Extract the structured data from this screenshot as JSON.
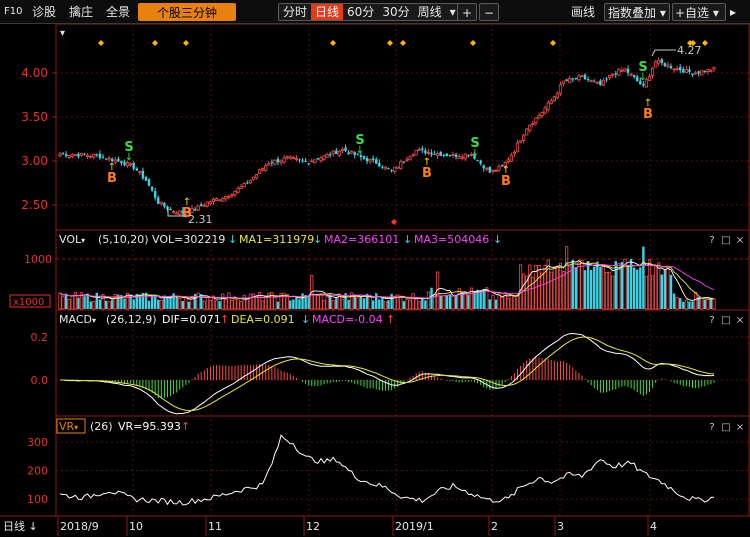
{
  "toolbar": {
    "f10": "F10",
    "diagnose": "诊股",
    "zhuozhu": "擒庄",
    "panorama": "全景",
    "stock_3min": "个股三分钟",
    "periods": [
      "分时",
      "日线",
      "60分",
      "30分",
      "周线"
    ],
    "active_period": "日线",
    "period_dropdown_icon": "chevron-down-icon",
    "plus": "+",
    "minus": "−",
    "draw_line": "画线",
    "index_overlay": "指数叠加",
    "add_watchlist": "+自选"
  },
  "main_chart": {
    "y_ticks": [
      "4.00",
      "3.50",
      "3.00",
      "2.50"
    ],
    "y_values": [
      4.0,
      3.5,
      3.0,
      2.5
    ],
    "ylim": [
      2.18,
      4.44
    ],
    "high_label": "4.27",
    "low_label": "2.31",
    "buy_label": "B",
    "sell_label": "S",
    "up_color": "#f24a4a",
    "down_color": "#3bd3e6"
  },
  "vol": {
    "name": "VOL",
    "params": "(5,10,20)",
    "vol_label": "VOL=302219",
    "ma1_label": "MA1=311979",
    "ma2_label": "MA2=366101",
    "ma3_label": "MA3=504046",
    "y_tick": "1000",
    "unit": "x1000",
    "ma1_color": "#ffffff",
    "ma2_color": "#e8e830",
    "ma3_color": "#ff40ff"
  },
  "macd": {
    "name": "MACD",
    "params": "(26,12,9)",
    "dif_label": "DIF=0.071",
    "dea_label": "DEA=0.091",
    "macd_label": "MACD=-0.04",
    "y_ticks": [
      "0.2",
      "0.0"
    ]
  },
  "vr": {
    "name": "VR",
    "params": "(26)",
    "value_label": "VR=95.393",
    "y_ticks": [
      "300",
      "200",
      "100"
    ]
  },
  "panel_icons": [
    "?",
    "□",
    "×"
  ],
  "xaxis": {
    "period_label": "日线",
    "labels": [
      "2018/9",
      "10",
      "11",
      "12",
      "2019/1",
      "2",
      "3",
      "4"
    ]
  },
  "chart_data": {
    "type": "candlestick",
    "period": "日线",
    "x": [
      "2018/9",
      "10",
      "11",
      "12",
      "2019/1",
      "2",
      "3",
      "4"
    ],
    "ylim": [
      2.18,
      4.44
    ],
    "annotations": [
      {
        "text": "4.27",
        "type": "high"
      },
      {
        "text": "2.31",
        "type": "low"
      },
      {
        "text": "B",
        "type": "buy",
        "count": 5
      },
      {
        "text": "S",
        "type": "sell",
        "count": 4
      }
    ],
    "indicators": {
      "VOL": {
        "params": "(5,10,20)",
        "VOL": 302219,
        "MA1": 311979,
        "MA2": 366101,
        "MA3": 504046
      },
      "MACD": {
        "params": "(26,12,9)",
        "DIF": 0.071,
        "DEA": 0.091,
        "MACD": -0.04
      },
      "VR": {
        "params": "(26)",
        "VR": 95.393
      }
    }
  }
}
